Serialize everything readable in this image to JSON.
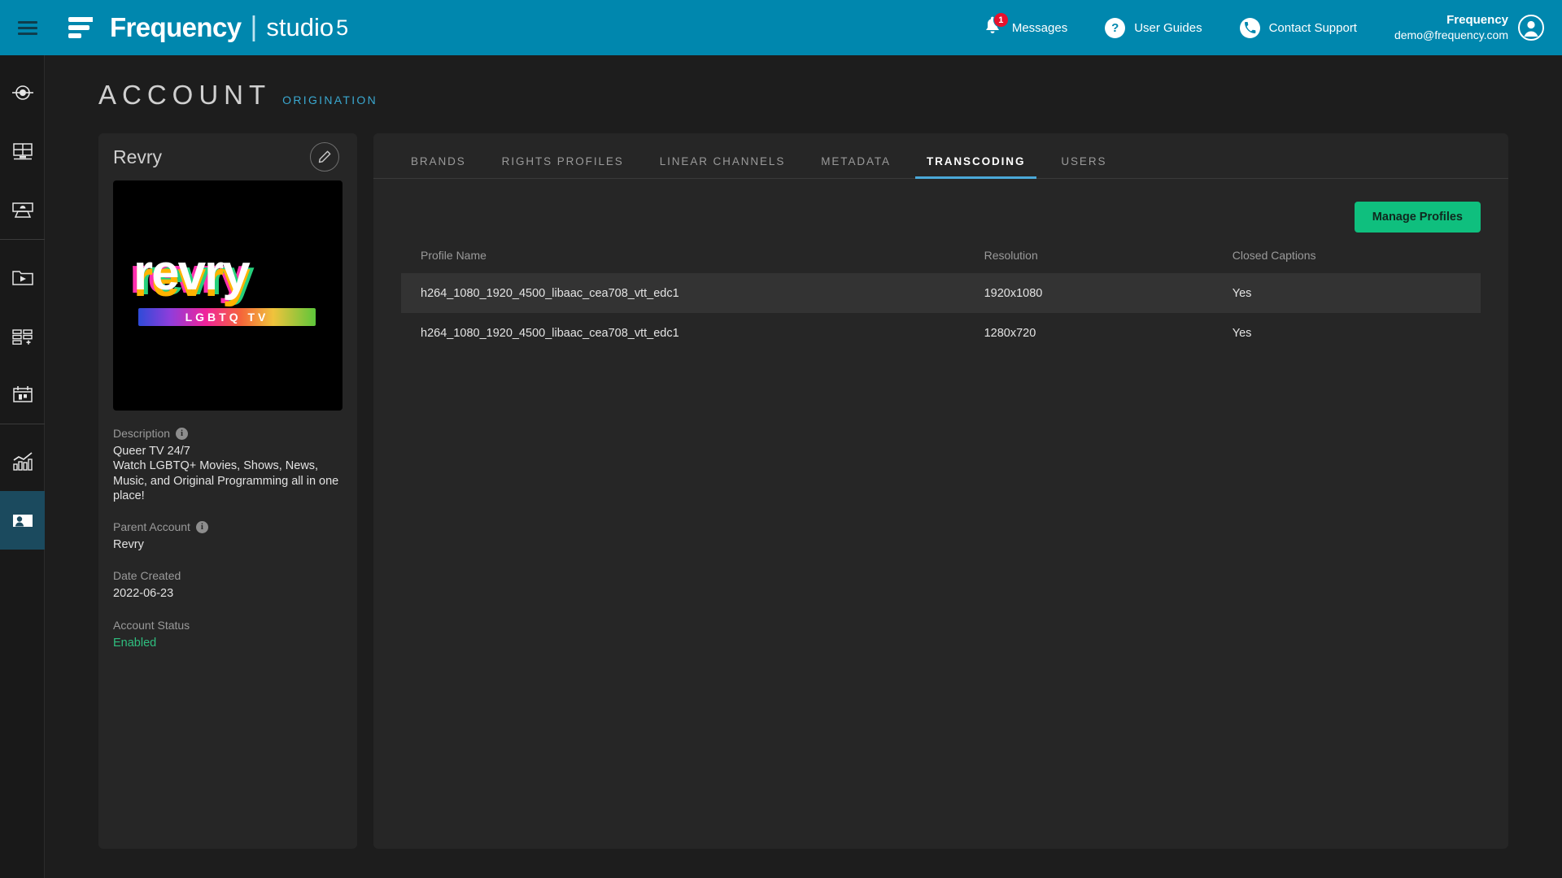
{
  "header": {
    "menu_icon": "hamburger-icon",
    "logo": {
      "brand": "Frequency",
      "divider": "|",
      "product": "studio",
      "suffix": "5"
    },
    "nav": [
      {
        "label": "Messages",
        "icon": "bell-icon",
        "badge": "1"
      },
      {
        "label": "User Guides",
        "icon": "question-mark-icon"
      },
      {
        "label": "Contact Support",
        "icon": "phone-icon"
      }
    ],
    "user": {
      "name": "Frequency",
      "email": "demo@frequency.com",
      "icon": "user-avatar-icon"
    },
    "accent_color": "#0087ae"
  },
  "sidebar": {
    "items": [
      {
        "name": "origination",
        "icon": "target-dot-icon",
        "active": false
      },
      {
        "name": "grid-layout",
        "icon": "monitor-grid-icon",
        "active": false
      },
      {
        "name": "presentation",
        "icon": "presentation-screen-icon",
        "active": false
      },
      {
        "name": "media-library",
        "icon": "folder-play-icon",
        "active": false
      },
      {
        "name": "add-playlist",
        "icon": "grid-plus-icon",
        "active": false
      },
      {
        "name": "scheduler",
        "icon": "calendar-blocks-icon",
        "active": false
      },
      {
        "name": "analytics",
        "icon": "bar-chart-trend-icon",
        "active": false
      },
      {
        "name": "account",
        "icon": "account-screen-icon",
        "active": true
      }
    ]
  },
  "page": {
    "title": "ACCOUNT",
    "subtitle": "ORIGINATION",
    "subtitle_color": "#3aa8d0"
  },
  "account_card": {
    "name": "Revry",
    "edit_icon": "pencil-edit-icon",
    "thumbnail": {
      "alt": "revry-logo",
      "wordmark": "revry",
      "tagline": "LGBTQ  TV"
    },
    "fields": [
      {
        "label": "Description",
        "has_info": true,
        "value": "Queer TV 24/7\nWatch LGBTQ+ Movies, Shows, News, Music, and Original Programming all in one place!"
      },
      {
        "label": "Parent Account",
        "has_info": true,
        "value": "Revry"
      },
      {
        "label": "Date Created",
        "has_info": false,
        "value": "2022-06-23"
      },
      {
        "label": "Account Status",
        "has_info": false,
        "value": "Enabled",
        "status_color": "#2fbf7f"
      }
    ],
    "description_label": "Description",
    "description_value_line1": "Queer TV 24/7",
    "description_value_line2": "Watch LGBTQ+ Movies, Shows, News, Music, and Original Programming all in one place!",
    "parent_label": "Parent Account",
    "parent_value": "Revry",
    "date_label": "Date Created",
    "date_value": "2022-06-23",
    "status_label": "Account Status",
    "status_value": "Enabled"
  },
  "tabs": [
    {
      "label": "BRANDS",
      "active": false
    },
    {
      "label": "RIGHTS PROFILES",
      "active": false
    },
    {
      "label": "LINEAR CHANNELS",
      "active": false
    },
    {
      "label": "METADATA",
      "active": false
    },
    {
      "label": "TRANSCODING",
      "active": true
    },
    {
      "label": "USERS",
      "active": false
    }
  ],
  "transcoding": {
    "manage_button": "Manage Profiles",
    "columns": [
      "Profile Name",
      "Resolution",
      "Closed Captions"
    ],
    "rows": [
      {
        "profile_name": "h264_1080_1920_4500_libaac_cea708_vtt_edc1",
        "resolution": "1920x1080",
        "closed_captions": "Yes",
        "highlighted": true
      },
      {
        "profile_name": "h264_1080_1920_4500_libaac_cea708_vtt_edc1",
        "resolution": "1280x720",
        "closed_captions": "Yes",
        "highlighted": false
      }
    ]
  }
}
